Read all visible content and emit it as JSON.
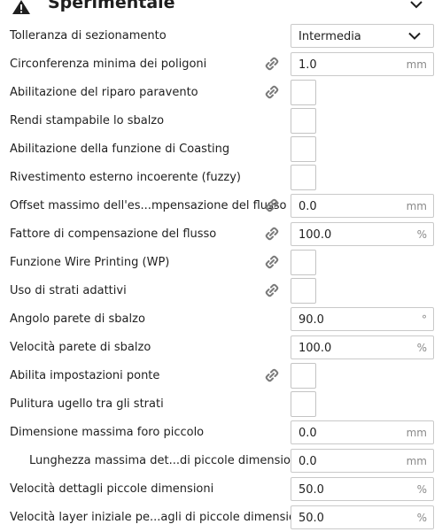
{
  "header": {
    "title": "Sperimentale",
    "icon": "warning-triangle-icon"
  },
  "rows": [
    {
      "label": "Tolleranza di sezionamento",
      "type": "select",
      "value": "Intermedia",
      "link": false
    },
    {
      "label": "Circonferenza minima dei poligoni",
      "type": "number",
      "value": "1.0",
      "unit": "mm",
      "link": true
    },
    {
      "label": "Abilitazione del riparo paravento",
      "type": "checkbox",
      "checked": false,
      "link": true
    },
    {
      "label": "Rendi stampabile lo sbalzo",
      "type": "checkbox",
      "checked": false,
      "link": false
    },
    {
      "label": "Abilitazione della funzione di Coasting",
      "type": "checkbox",
      "checked": false,
      "link": false
    },
    {
      "label": "Rivestimento esterno incoerente (fuzzy)",
      "type": "checkbox",
      "checked": false,
      "link": false
    },
    {
      "label": "Offset massimo dell'es...mpensazione del flusso",
      "type": "number",
      "value": "0.0",
      "unit": "mm",
      "link": true
    },
    {
      "label": "Fattore di compensazione del flusso",
      "type": "number",
      "value": "100.0",
      "unit": "%",
      "link": true
    },
    {
      "label": "Funzione Wire Printing (WP)",
      "type": "checkbox",
      "checked": false,
      "link": true
    },
    {
      "label": "Uso di strati adattivi",
      "type": "checkbox",
      "checked": false,
      "link": true
    },
    {
      "label": "Angolo parete di sbalzo",
      "type": "number",
      "value": "90.0",
      "unit": "°",
      "link": false
    },
    {
      "label": "Velocità parete di sbalzo",
      "type": "number",
      "value": "100.0",
      "unit": "%",
      "link": false
    },
    {
      "label": "Abilita impostazioni ponte",
      "type": "checkbox",
      "checked": false,
      "link": true
    },
    {
      "label": "Pulitura ugello tra gli strati",
      "type": "checkbox",
      "checked": false,
      "link": false
    },
    {
      "label": "Dimensione massima foro piccolo",
      "type": "number",
      "value": "0.0",
      "unit": "mm",
      "link": false
    },
    {
      "label": "Lunghezza massima det...di piccole dimensioni",
      "type": "number",
      "value": "0.0",
      "unit": "mm",
      "link": false,
      "child": true
    },
    {
      "label": "Velocità dettagli piccole dimensioni",
      "type": "number",
      "value": "50.0",
      "unit": "%",
      "link": false
    },
    {
      "label": "Velocità layer iniziale pe...agli di piccole dimensioni",
      "type": "number",
      "value": "50.0",
      "unit": "%",
      "link": false
    }
  ]
}
